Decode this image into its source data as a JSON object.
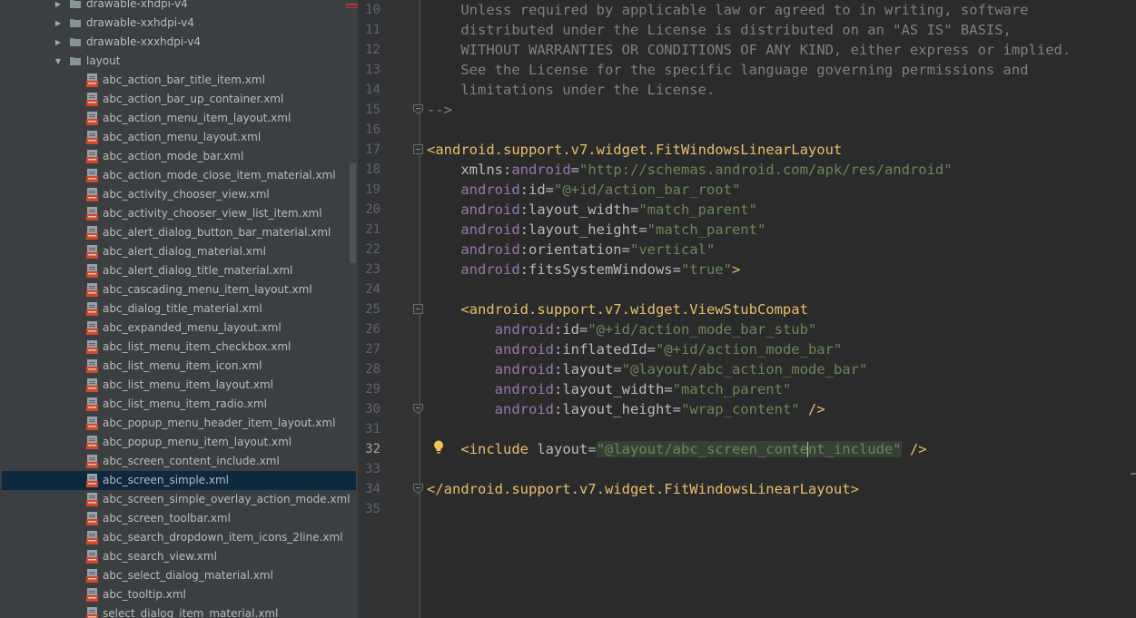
{
  "project_tree": {
    "folders": [
      {
        "label": "drawable-xhdpi-v4",
        "expanded": false
      },
      {
        "label": "drawable-xxhdpi-v4",
        "expanded": false
      },
      {
        "label": "drawable-xxxhdpi-v4",
        "expanded": false
      },
      {
        "label": "layout",
        "expanded": true
      }
    ],
    "files": [
      "abc_action_bar_title_item.xml",
      "abc_action_bar_up_container.xml",
      "abc_action_menu_item_layout.xml",
      "abc_action_menu_layout.xml",
      "abc_action_mode_bar.xml",
      "abc_action_mode_close_item_material.xml",
      "abc_activity_chooser_view.xml",
      "abc_activity_chooser_view_list_item.xml",
      "abc_alert_dialog_button_bar_material.xml",
      "abc_alert_dialog_material.xml",
      "abc_alert_dialog_title_material.xml",
      "abc_cascading_menu_item_layout.xml",
      "abc_dialog_title_material.xml",
      "abc_expanded_menu_layout.xml",
      "abc_list_menu_item_checkbox.xml",
      "abc_list_menu_item_icon.xml",
      "abc_list_menu_item_layout.xml",
      "abc_list_menu_item_radio.xml",
      "abc_popup_menu_header_item_layout.xml",
      "abc_popup_menu_item_layout.xml",
      "abc_screen_content_include.xml",
      "abc_screen_simple.xml",
      "abc_screen_simple_overlay_action_mode.xml",
      "abc_screen_toolbar.xml",
      "abc_search_dropdown_item_icons_2line.xml",
      "abc_search_view.xml",
      "abc_select_dialog_material.xml",
      "abc_tooltip.xml",
      "select_dialog_item_material.xml"
    ],
    "selected_file": "abc_screen_simple.xml"
  },
  "editor": {
    "current_line": "32",
    "lines": [
      {
        "num": "10",
        "fold": "none",
        "tokens": [
          {
            "t": "comment",
            "v": "    Unless required by applicable law or agreed to in writing, software"
          }
        ]
      },
      {
        "num": "11",
        "fold": "none",
        "tokens": [
          {
            "t": "comment",
            "v": "    distributed under the License is distributed on an \"AS IS\" BASIS,"
          }
        ]
      },
      {
        "num": "12",
        "fold": "none",
        "tokens": [
          {
            "t": "comment",
            "v": "    WITHOUT WARRANTIES OR CONDITIONS OF ANY KIND, either express or implied."
          }
        ]
      },
      {
        "num": "13",
        "fold": "none",
        "tokens": [
          {
            "t": "comment",
            "v": "    See the License for the specific language governing permissions and"
          }
        ]
      },
      {
        "num": "14",
        "fold": "none",
        "tokens": [
          {
            "t": "comment",
            "v": "    limitations under the License."
          }
        ]
      },
      {
        "num": "15",
        "fold": "end",
        "tokens": [
          {
            "t": "comment",
            "v": "-->"
          }
        ]
      },
      {
        "num": "16",
        "fold": "none",
        "tokens": []
      },
      {
        "num": "17",
        "fold": "start",
        "tokens": [
          {
            "t": "tag",
            "v": "<android.support.v7.widget.FitWindowsLinearLayout"
          }
        ]
      },
      {
        "num": "18",
        "fold": "none",
        "tokens": [
          {
            "t": "plain",
            "v": "    "
          },
          {
            "t": "attr",
            "v": "xmlns:"
          },
          {
            "t": "ns",
            "v": "android"
          },
          {
            "t": "plain",
            "v": "="
          },
          {
            "t": "val",
            "v": "\"http://schemas.android.com/apk/res/android\""
          }
        ]
      },
      {
        "num": "19",
        "fold": "none",
        "tokens": [
          {
            "t": "plain",
            "v": "    "
          },
          {
            "t": "ns",
            "v": "android"
          },
          {
            "t": "attr",
            "v": ":id"
          },
          {
            "t": "plain",
            "v": "="
          },
          {
            "t": "val",
            "v": "\"@+id/action_bar_root\""
          }
        ]
      },
      {
        "num": "20",
        "fold": "none",
        "tokens": [
          {
            "t": "plain",
            "v": "    "
          },
          {
            "t": "ns",
            "v": "android"
          },
          {
            "t": "attr",
            "v": ":layout_width"
          },
          {
            "t": "plain",
            "v": "="
          },
          {
            "t": "val",
            "v": "\"match_parent\""
          }
        ]
      },
      {
        "num": "21",
        "fold": "none",
        "tokens": [
          {
            "t": "plain",
            "v": "    "
          },
          {
            "t": "ns",
            "v": "android"
          },
          {
            "t": "attr",
            "v": ":layout_height"
          },
          {
            "t": "plain",
            "v": "="
          },
          {
            "t": "val",
            "v": "\"match_parent\""
          }
        ]
      },
      {
        "num": "22",
        "fold": "none",
        "tokens": [
          {
            "t": "plain",
            "v": "    "
          },
          {
            "t": "ns",
            "v": "android"
          },
          {
            "t": "attr",
            "v": ":orientation"
          },
          {
            "t": "plain",
            "v": "="
          },
          {
            "t": "val",
            "v": "\"vertical\""
          }
        ]
      },
      {
        "num": "23",
        "fold": "none",
        "tokens": [
          {
            "t": "plain",
            "v": "    "
          },
          {
            "t": "ns",
            "v": "android"
          },
          {
            "t": "attr",
            "v": ":fitsSystemWindows"
          },
          {
            "t": "plain",
            "v": "="
          },
          {
            "t": "val",
            "v": "\"true\""
          },
          {
            "t": "tag",
            "v": ">"
          }
        ]
      },
      {
        "num": "24",
        "fold": "none",
        "tokens": []
      },
      {
        "num": "25",
        "fold": "start",
        "tokens": [
          {
            "t": "plain",
            "v": "    "
          },
          {
            "t": "tag",
            "v": "<android.support.v7.widget.ViewStubCompat"
          }
        ]
      },
      {
        "num": "26",
        "fold": "none",
        "tokens": [
          {
            "t": "plain",
            "v": "        "
          },
          {
            "t": "ns",
            "v": "android"
          },
          {
            "t": "attr",
            "v": ":id"
          },
          {
            "t": "plain",
            "v": "="
          },
          {
            "t": "val",
            "v": "\"@+id/action_mode_bar_stub\""
          }
        ]
      },
      {
        "num": "27",
        "fold": "none",
        "tokens": [
          {
            "t": "plain",
            "v": "        "
          },
          {
            "t": "ns",
            "v": "android"
          },
          {
            "t": "attr",
            "v": ":inflatedId"
          },
          {
            "t": "plain",
            "v": "="
          },
          {
            "t": "val",
            "v": "\"@+id/action_mode_bar\""
          }
        ]
      },
      {
        "num": "28",
        "fold": "none",
        "tokens": [
          {
            "t": "plain",
            "v": "        "
          },
          {
            "t": "ns",
            "v": "android"
          },
          {
            "t": "attr",
            "v": ":layout"
          },
          {
            "t": "plain",
            "v": "="
          },
          {
            "t": "val",
            "v": "\"@layout/abc_action_mode_bar\""
          }
        ]
      },
      {
        "num": "29",
        "fold": "none",
        "tokens": [
          {
            "t": "plain",
            "v": "        "
          },
          {
            "t": "ns",
            "v": "android"
          },
          {
            "t": "attr",
            "v": ":layout_width"
          },
          {
            "t": "plain",
            "v": "="
          },
          {
            "t": "val",
            "v": "\"match_parent\""
          }
        ]
      },
      {
        "num": "30",
        "fold": "end",
        "tokens": [
          {
            "t": "plain",
            "v": "        "
          },
          {
            "t": "ns",
            "v": "android"
          },
          {
            "t": "attr",
            "v": ":layout_height"
          },
          {
            "t": "plain",
            "v": "="
          },
          {
            "t": "val",
            "v": "\"wrap_content\""
          },
          {
            "t": "plain",
            "v": " "
          },
          {
            "t": "tag",
            "v": "/>"
          }
        ]
      },
      {
        "num": "31",
        "fold": "none",
        "tokens": []
      },
      {
        "num": "32",
        "fold": "none",
        "tokens": [
          {
            "t": "plain",
            "v": "    "
          },
          {
            "t": "tag",
            "v": "<include "
          },
          {
            "t": "attr",
            "v": "layout"
          },
          {
            "t": "plain",
            "v": "="
          },
          {
            "t": "val-hl",
            "v": "\"@layout/abc_screen_conte"
          },
          {
            "t": "cursor",
            "v": ""
          },
          {
            "t": "val-hl",
            "v": "nt_include\""
          },
          {
            "t": "plain",
            "v": " "
          },
          {
            "t": "tag",
            "v": "/>"
          }
        ]
      },
      {
        "num": "33",
        "fold": "none",
        "tokens": []
      },
      {
        "num": "34",
        "fold": "end",
        "tokens": [
          {
            "t": "tag",
            "v": "</android.support.v7.widget.FitWindowsLinearLayout>"
          }
        ]
      },
      {
        "num": "35",
        "fold": "none",
        "tokens": []
      }
    ]
  },
  "colors": {
    "tree_background": "#3c3f41",
    "tree_selection": "#0d293e",
    "editor_background": "#2b2b2b",
    "gutter_background": "#313335",
    "comment": "#808080",
    "tag": "#e8bf6a",
    "namespace": "#9876aa",
    "attribute": "#bababa",
    "string_value": "#6a8759"
  },
  "icons": {
    "folder": "folder-icon",
    "xml_file": "xml-file-icon",
    "expand": "chevron-right-icon",
    "collapse": "chevron-down-icon",
    "intention": "lightbulb-icon"
  }
}
